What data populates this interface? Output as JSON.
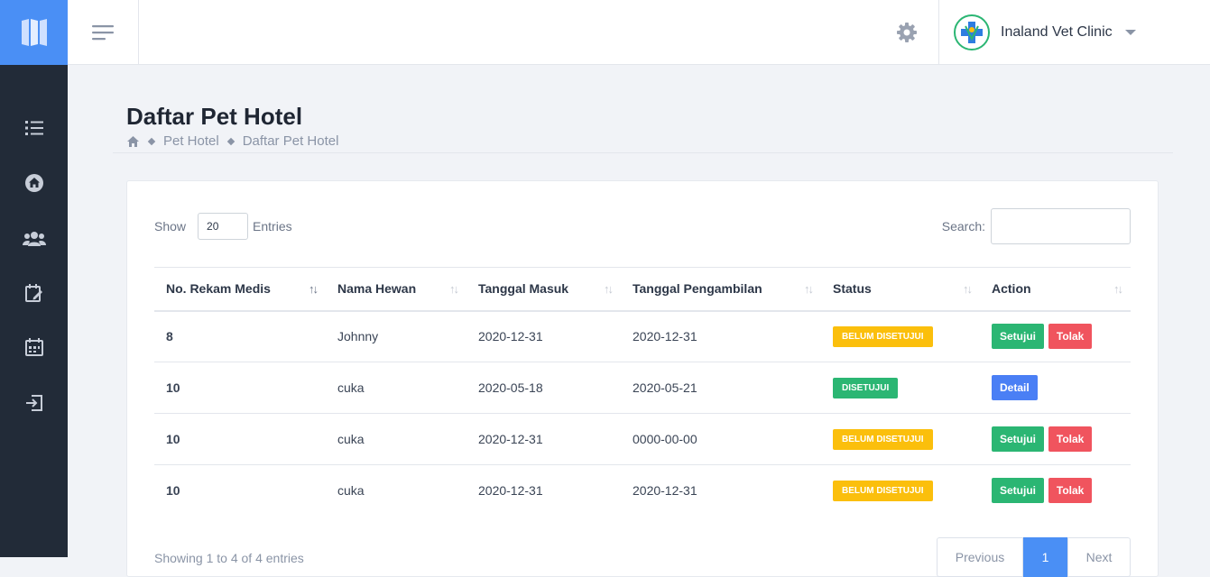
{
  "header": {
    "clinic_name": "Inaland Vet Clinic"
  },
  "page": {
    "title": "Daftar Pet Hotel",
    "breadcrumb": [
      "Pet Hotel",
      "Daftar Pet Hotel"
    ]
  },
  "sidebar": {
    "items": [
      "list-icon",
      "home-icon",
      "users-icon",
      "edit-calendar-icon",
      "calendar-icon",
      "logout-icon"
    ]
  },
  "table_controls": {
    "show_label": "Show",
    "entries_value": "20",
    "entries_label": "Entries",
    "search_label": "Search:",
    "search_value": ""
  },
  "table": {
    "columns": [
      "No. Rekam Medis",
      "Nama Hewan",
      "Tanggal Masuk",
      "Tanggal Pengambilan",
      "Status",
      "Action"
    ],
    "rows": [
      {
        "no": "8",
        "nama": "Johnny",
        "masuk": "2020-12-31",
        "ambil": "2020-12-31",
        "status": "BELUM DISETUJUI",
        "status_type": "warn",
        "actions": [
          "Setujui",
          "Tolak"
        ]
      },
      {
        "no": "10",
        "nama": "cuka",
        "masuk": "2020-05-18",
        "ambil": "2020-05-21",
        "status": "DISETUJUI",
        "status_type": "ok",
        "actions": [
          "Detail"
        ]
      },
      {
        "no": "10",
        "nama": "cuka",
        "masuk": "2020-12-31",
        "ambil": "0000-00-00",
        "status": "BELUM DISETUJUI",
        "status_type": "warn",
        "actions": [
          "Setujui",
          "Tolak"
        ]
      },
      {
        "no": "10",
        "nama": "cuka",
        "masuk": "2020-12-31",
        "ambil": "2020-12-31",
        "status": "BELUM DISETUJUI",
        "status_type": "warn",
        "actions": [
          "Setujui",
          "Tolak"
        ]
      }
    ]
  },
  "footer": {
    "info": "Showing 1 to 4 of 4 entries",
    "prev": "Previous",
    "page": "1",
    "next": "Next"
  },
  "colors": {
    "sidebar": "#222b38",
    "accent": "#4a8ff5",
    "success": "#2bb673",
    "warning": "#fbbf0c",
    "danger": "#f0545e"
  }
}
